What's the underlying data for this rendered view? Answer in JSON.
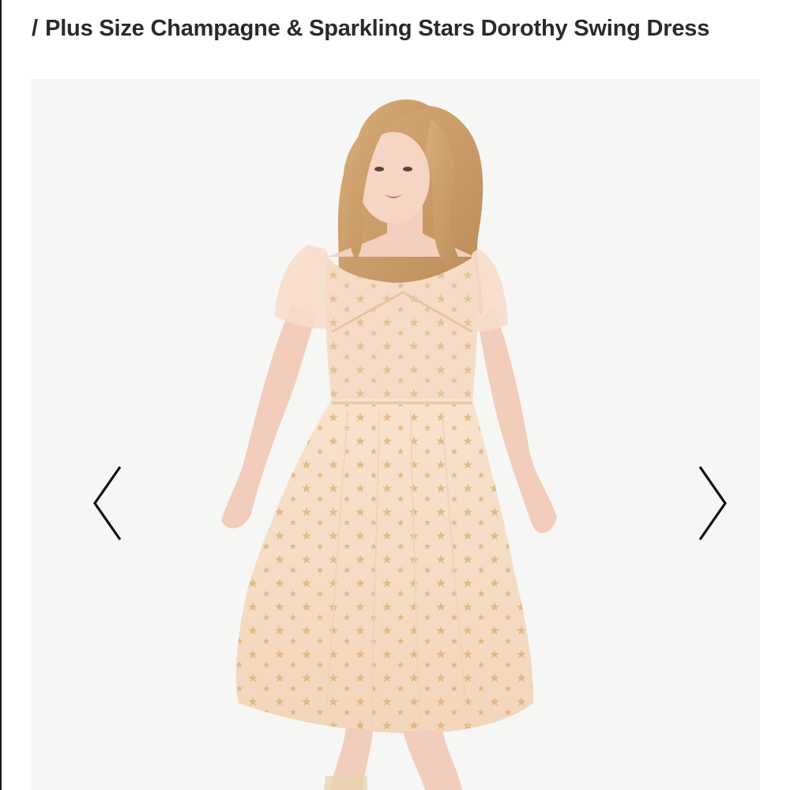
{
  "header": {
    "separator": "/",
    "title": "Plus Size Champagne & Sparkling Stars Dorothy Swing Dress"
  },
  "carousel": {
    "prev_icon": "chevron-left-icon",
    "next_icon": "chevron-right-icon",
    "image_subject": "model-wearing-champagne-star-swing-dress"
  },
  "colors": {
    "title_text": "#2a2a2a",
    "image_background": "#f6f6f5",
    "dress": "#f5dcc4",
    "stars": "#d4a35f",
    "arrow": "#111111"
  }
}
